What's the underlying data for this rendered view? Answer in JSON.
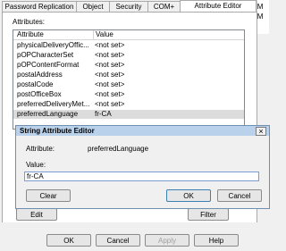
{
  "tabs": [
    {
      "label": "Password Replication"
    },
    {
      "label": "Object"
    },
    {
      "label": "Security"
    },
    {
      "label": "COM+"
    },
    {
      "label": "Attribute Editor"
    }
  ],
  "right_strip": [
    "curite M",
    "curite M"
  ],
  "attributes_label": "Attributes:",
  "columns": {
    "attribute": "Attribute",
    "value": "Value"
  },
  "rows": [
    {
      "attr": "physicalDeliveryOffic...",
      "value": "<not set>"
    },
    {
      "attr": "pOPCharacterSet",
      "value": "<not set>"
    },
    {
      "attr": "pOPContentFormat",
      "value": "<not set>"
    },
    {
      "attr": "postalAddress",
      "value": "<not set>"
    },
    {
      "attr": "postalCode",
      "value": "<not set>"
    },
    {
      "attr": "postOfficeBox",
      "value": "<not set>"
    },
    {
      "attr": "preferredDeliveryMet...",
      "value": "<not set>"
    },
    {
      "attr": "preferredLanguage",
      "value": "fr-CA"
    }
  ],
  "panel_buttons": {
    "edit": "Edit",
    "filter": "Filter"
  },
  "dialog": {
    "title": "String Attribute Editor",
    "close": "×",
    "attribute_label": "Attribute:",
    "attribute_value": "preferredLanguage",
    "value_label": "Value:",
    "value": "fr-CA",
    "clear": "Clear",
    "ok": "OK",
    "cancel": "Cancel"
  },
  "bottom_buttons": {
    "ok": "OK",
    "cancel": "Cancel",
    "apply": "Apply",
    "help": "Help"
  }
}
